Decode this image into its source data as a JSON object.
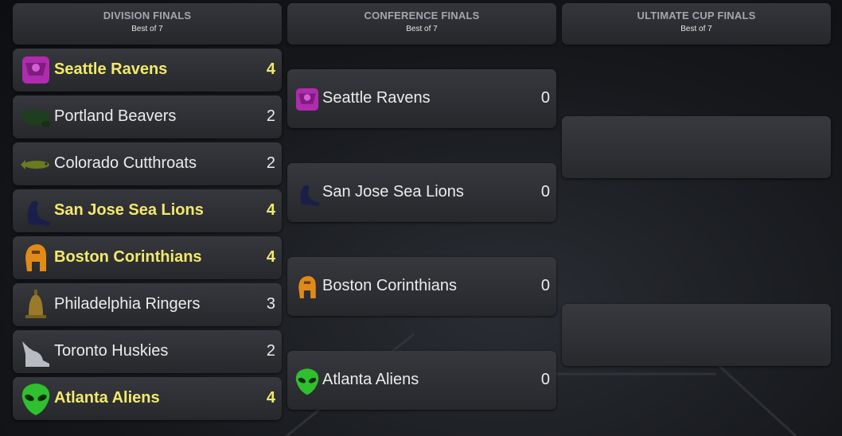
{
  "columns": [
    {
      "title": "DIVISION FINALS",
      "subtitle": "Best of 7"
    },
    {
      "title": "CONFERENCE FINALS",
      "subtitle": "Best of 7"
    },
    {
      "title": "ULTIMATE CUP FINALS",
      "subtitle": "Best of 7"
    }
  ],
  "division": [
    {
      "team": "Seattle Ravens",
      "score": "4",
      "winner": true,
      "icon": "raven-icon",
      "color": "#b02bb0"
    },
    {
      "team": "Portland Beavers",
      "score": "2",
      "winner": false,
      "icon": "beaver-icon",
      "color": "#1f3d1f"
    },
    {
      "team": "Colorado Cutthroats",
      "score": "2",
      "winner": false,
      "icon": "trout-icon",
      "color": "#6b7a1e"
    },
    {
      "team": "San Jose Sea Lions",
      "score": "4",
      "winner": true,
      "icon": "sea-lion-icon",
      "color": "#1a1f4a"
    },
    {
      "team": "Boston Corinthians",
      "score": "4",
      "winner": true,
      "icon": "helmet-icon",
      "color": "#e08a1a"
    },
    {
      "team": "Philadelphia Ringers",
      "score": "3",
      "winner": false,
      "icon": "bell-icon",
      "color": "#9a7a2a"
    },
    {
      "team": "Toronto Huskies",
      "score": "2",
      "winner": false,
      "icon": "husky-icon",
      "color": "#b8bcc2"
    },
    {
      "team": "Atlanta Aliens",
      "score": "4",
      "winner": true,
      "icon": "alien-icon",
      "color": "#2fbf2f"
    }
  ],
  "conference": [
    {
      "team": "Seattle Ravens",
      "score": "0",
      "icon": "raven-icon"
    },
    {
      "team": "San Jose Sea Lions",
      "score": "0",
      "icon": "sea-lion-icon"
    },
    {
      "team": "Boston Corinthians",
      "score": "0",
      "icon": "helmet-icon"
    },
    {
      "team": "Atlanta Aliens",
      "score": "0",
      "icon": "alien-icon"
    }
  ],
  "colors": {
    "winner_text": "#f3e96b",
    "text": "#ececec",
    "header_text": "#a4a6ab"
  }
}
